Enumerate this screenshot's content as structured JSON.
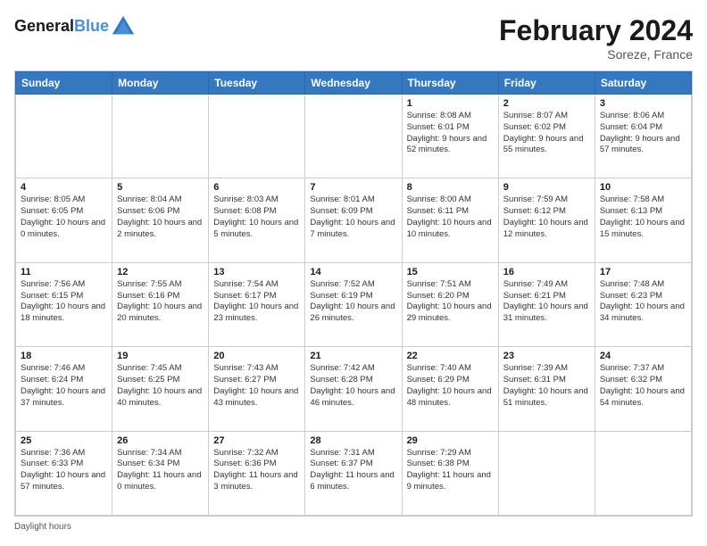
{
  "header": {
    "logo_line1": "General",
    "logo_line2": "Blue",
    "month_title": "February 2024",
    "subtitle": "Soreze, France"
  },
  "days_of_week": [
    "Sunday",
    "Monday",
    "Tuesday",
    "Wednesday",
    "Thursday",
    "Friday",
    "Saturday"
  ],
  "footer": {
    "daylight_label": "Daylight hours"
  },
  "weeks": [
    [
      {
        "day": "",
        "info": ""
      },
      {
        "day": "",
        "info": ""
      },
      {
        "day": "",
        "info": ""
      },
      {
        "day": "",
        "info": ""
      },
      {
        "day": "1",
        "info": "Sunrise: 8:08 AM\nSunset: 6:01 PM\nDaylight: 9 hours and 52 minutes."
      },
      {
        "day": "2",
        "info": "Sunrise: 8:07 AM\nSunset: 6:02 PM\nDaylight: 9 hours and 55 minutes."
      },
      {
        "day": "3",
        "info": "Sunrise: 8:06 AM\nSunset: 6:04 PM\nDaylight: 9 hours and 57 minutes."
      }
    ],
    [
      {
        "day": "4",
        "info": "Sunrise: 8:05 AM\nSunset: 6:05 PM\nDaylight: 10 hours and 0 minutes."
      },
      {
        "day": "5",
        "info": "Sunrise: 8:04 AM\nSunset: 6:06 PM\nDaylight: 10 hours and 2 minutes."
      },
      {
        "day": "6",
        "info": "Sunrise: 8:03 AM\nSunset: 6:08 PM\nDaylight: 10 hours and 5 minutes."
      },
      {
        "day": "7",
        "info": "Sunrise: 8:01 AM\nSunset: 6:09 PM\nDaylight: 10 hours and 7 minutes."
      },
      {
        "day": "8",
        "info": "Sunrise: 8:00 AM\nSunset: 6:11 PM\nDaylight: 10 hours and 10 minutes."
      },
      {
        "day": "9",
        "info": "Sunrise: 7:59 AM\nSunset: 6:12 PM\nDaylight: 10 hours and 12 minutes."
      },
      {
        "day": "10",
        "info": "Sunrise: 7:58 AM\nSunset: 6:13 PM\nDaylight: 10 hours and 15 minutes."
      }
    ],
    [
      {
        "day": "11",
        "info": "Sunrise: 7:56 AM\nSunset: 6:15 PM\nDaylight: 10 hours and 18 minutes."
      },
      {
        "day": "12",
        "info": "Sunrise: 7:55 AM\nSunset: 6:16 PM\nDaylight: 10 hours and 20 minutes."
      },
      {
        "day": "13",
        "info": "Sunrise: 7:54 AM\nSunset: 6:17 PM\nDaylight: 10 hours and 23 minutes."
      },
      {
        "day": "14",
        "info": "Sunrise: 7:52 AM\nSunset: 6:19 PM\nDaylight: 10 hours and 26 minutes."
      },
      {
        "day": "15",
        "info": "Sunrise: 7:51 AM\nSunset: 6:20 PM\nDaylight: 10 hours and 29 minutes."
      },
      {
        "day": "16",
        "info": "Sunrise: 7:49 AM\nSunset: 6:21 PM\nDaylight: 10 hours and 31 minutes."
      },
      {
        "day": "17",
        "info": "Sunrise: 7:48 AM\nSunset: 6:23 PM\nDaylight: 10 hours and 34 minutes."
      }
    ],
    [
      {
        "day": "18",
        "info": "Sunrise: 7:46 AM\nSunset: 6:24 PM\nDaylight: 10 hours and 37 minutes."
      },
      {
        "day": "19",
        "info": "Sunrise: 7:45 AM\nSunset: 6:25 PM\nDaylight: 10 hours and 40 minutes."
      },
      {
        "day": "20",
        "info": "Sunrise: 7:43 AM\nSunset: 6:27 PM\nDaylight: 10 hours and 43 minutes."
      },
      {
        "day": "21",
        "info": "Sunrise: 7:42 AM\nSunset: 6:28 PM\nDaylight: 10 hours and 46 minutes."
      },
      {
        "day": "22",
        "info": "Sunrise: 7:40 AM\nSunset: 6:29 PM\nDaylight: 10 hours and 48 minutes."
      },
      {
        "day": "23",
        "info": "Sunrise: 7:39 AM\nSunset: 6:31 PM\nDaylight: 10 hours and 51 minutes."
      },
      {
        "day": "24",
        "info": "Sunrise: 7:37 AM\nSunset: 6:32 PM\nDaylight: 10 hours and 54 minutes."
      }
    ],
    [
      {
        "day": "25",
        "info": "Sunrise: 7:36 AM\nSunset: 6:33 PM\nDaylight: 10 hours and 57 minutes."
      },
      {
        "day": "26",
        "info": "Sunrise: 7:34 AM\nSunset: 6:34 PM\nDaylight: 11 hours and 0 minutes."
      },
      {
        "day": "27",
        "info": "Sunrise: 7:32 AM\nSunset: 6:36 PM\nDaylight: 11 hours and 3 minutes."
      },
      {
        "day": "28",
        "info": "Sunrise: 7:31 AM\nSunset: 6:37 PM\nDaylight: 11 hours and 6 minutes."
      },
      {
        "day": "29",
        "info": "Sunrise: 7:29 AM\nSunset: 6:38 PM\nDaylight: 11 hours and 9 minutes."
      },
      {
        "day": "",
        "info": ""
      },
      {
        "day": "",
        "info": ""
      }
    ]
  ]
}
